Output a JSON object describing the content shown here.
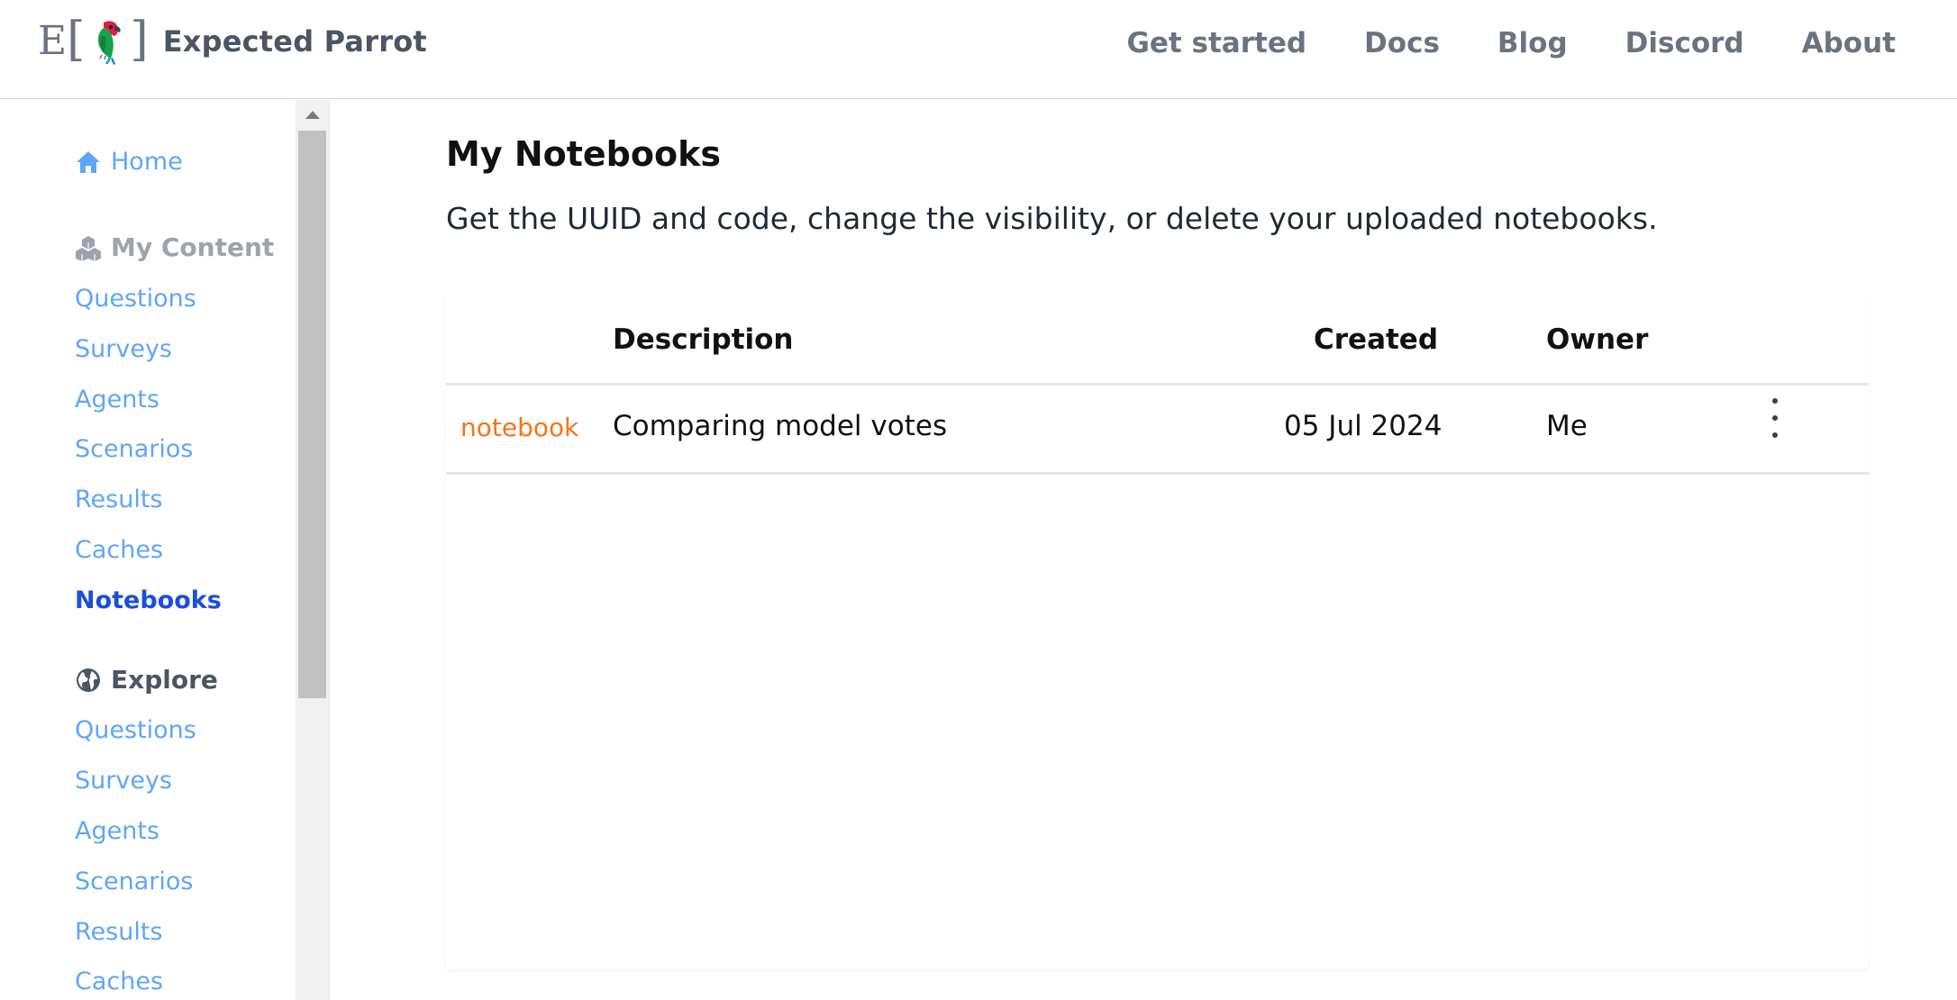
{
  "brand": {
    "name": "Expected Parrot",
    "logo_letter": "E"
  },
  "topnav": [
    {
      "label": "Get started"
    },
    {
      "label": "Docs"
    },
    {
      "label": "Blog"
    },
    {
      "label": "Discord"
    },
    {
      "label": "About"
    }
  ],
  "sidebar": {
    "home": "Home",
    "my_content": {
      "title": "My Content",
      "items": [
        "Questions",
        "Surveys",
        "Agents",
        "Scenarios",
        "Results",
        "Caches",
        "Notebooks"
      ],
      "active": "Notebooks"
    },
    "explore": {
      "title": "Explore",
      "items": [
        "Questions",
        "Surveys",
        "Agents",
        "Scenarios",
        "Results",
        "Caches"
      ]
    }
  },
  "page": {
    "title": "My Notebooks",
    "subtitle": "Get the UUID and code, change the visibility, or delete your uploaded notebooks."
  },
  "table": {
    "headers": {
      "description": "Description",
      "created": "Created",
      "owner": "Owner"
    },
    "rows": [
      {
        "type": "notebook",
        "description": "Comparing model votes",
        "created": "05 Jul 2024",
        "owner": "Me"
      }
    ]
  },
  "colors": {
    "link": "#60a5fa",
    "active_link": "#1d4ed8",
    "type_badge": "#f97316"
  }
}
